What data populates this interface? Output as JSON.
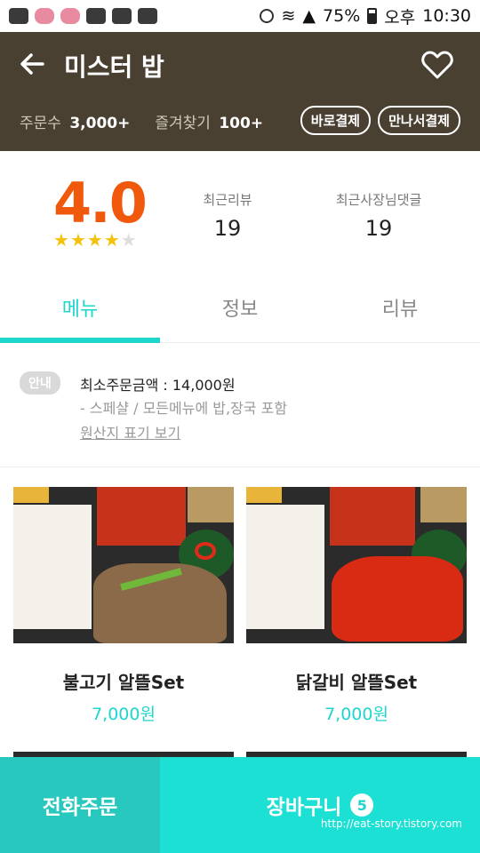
{
  "status_bar": {
    "battery": "75%",
    "ampm": "오후",
    "time": "10:30"
  },
  "header": {
    "title": "미스터 밥",
    "order_label": "주문수",
    "order_count": "3,000+",
    "fav_label": "즐겨찾기",
    "fav_count": "100+",
    "pay_direct": "바로결제",
    "pay_meet": "만나서결제"
  },
  "rating": {
    "score": "4.0",
    "stars": 4,
    "stars_max": 5,
    "review_label": "최근리뷰",
    "review_count": "19",
    "owner_label": "최근사장님댓글",
    "owner_count": "19"
  },
  "tabs": [
    {
      "label": "메뉴"
    },
    {
      "label": "정보"
    },
    {
      "label": "리뷰"
    }
  ],
  "notice": {
    "badge": "안내",
    "min_order": "최소주문금액 : 14,000원",
    "note": "- 스페샬 / 모든메뉴에 밥,장국 포함",
    "origin_link": "원산지 표기 보기"
  },
  "menu": [
    {
      "name": "불고기 알뜰Set",
      "price": "7,000원"
    },
    {
      "name": "닭갈비 알뜰Set",
      "price": "7,000원"
    }
  ],
  "bottom": {
    "call": "전화주문",
    "cart": "장바구니",
    "cart_count": "5",
    "watermark": "http://eat-story.tistory.com"
  },
  "colors": {
    "accent": "#1dd6cc",
    "header_bg": "#4a4032",
    "score": "#f0590c"
  }
}
